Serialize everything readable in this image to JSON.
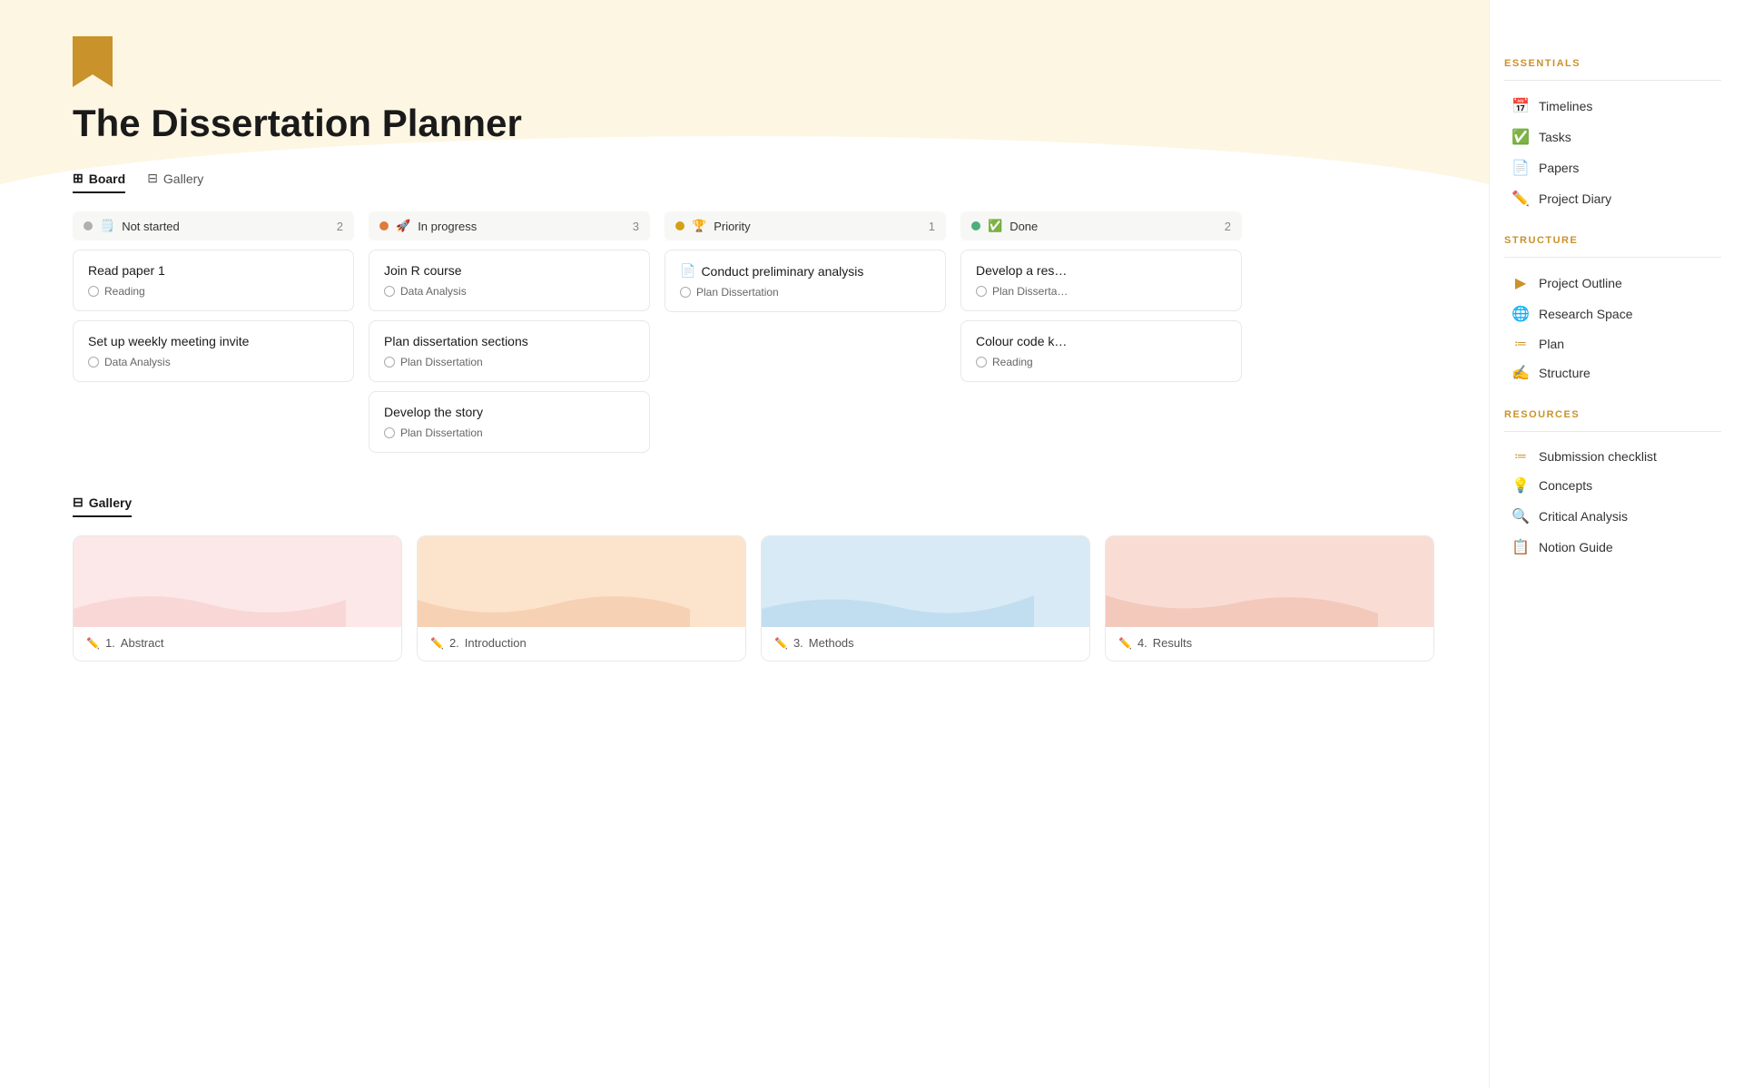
{
  "page": {
    "title": "The Dissertation Planner",
    "icon": "bookmark"
  },
  "tabs": [
    {
      "id": "board",
      "label": "Board",
      "icon": "⊞",
      "active": true
    },
    {
      "id": "gallery",
      "label": "Gallery",
      "icon": "⊟",
      "active": false
    }
  ],
  "board": {
    "columns": [
      {
        "id": "not-started",
        "status_dot": "gray",
        "emoji": "🗒️",
        "label": "Not started",
        "count": 2,
        "cards": [
          {
            "title": "Read paper 1",
            "doc_icon": null,
            "tag": "Reading"
          },
          {
            "title": "Set up weekly meeting invite",
            "doc_icon": null,
            "tag": "Data Analysis"
          }
        ]
      },
      {
        "id": "in-progress",
        "status_dot": "orange",
        "emoji": "🚀",
        "label": "In progress",
        "count": 3,
        "cards": [
          {
            "title": "Join R course",
            "doc_icon": null,
            "tag": "Data Analysis"
          },
          {
            "title": "Plan dissertation sections",
            "doc_icon": null,
            "tag": "Plan Dissertation"
          },
          {
            "title": "Develop the story",
            "doc_icon": null,
            "tag": "Plan Dissertation"
          }
        ]
      },
      {
        "id": "priority",
        "status_dot": "yellow",
        "emoji": "🏆",
        "label": "Priority",
        "count": 1,
        "cards": [
          {
            "title": "Conduct preliminary analysis",
            "doc_icon": "📄",
            "tag": "Plan Dissertation"
          }
        ]
      },
      {
        "id": "done",
        "status_dot": "green",
        "emoji": "✅",
        "label": "Done",
        "count": 2,
        "cards": [
          {
            "title": "Develop a res…",
            "doc_icon": null,
            "tag": "Plan Disserta…"
          },
          {
            "title": "Colour code k…",
            "doc_icon": null,
            "tag": "Reading"
          }
        ]
      }
    ]
  },
  "gallery": {
    "cards": [
      {
        "number": "1",
        "label": "Abstract",
        "color_class": "gc-pink",
        "wave_color": "#f8d0d0"
      },
      {
        "number": "2",
        "label": "Introduction",
        "color_class": "gc-peach",
        "wave_color": "#f5c9a8"
      },
      {
        "number": "3",
        "label": "Methods",
        "color_class": "gc-blue",
        "wave_color": "#b8d8ee"
      },
      {
        "number": "4",
        "label": "Results",
        "color_class": "gc-salmon",
        "wave_color": "#f0c0b0"
      }
    ]
  },
  "sidebar": {
    "essentials_title": "ESSENTIALS",
    "structure_title": "STRUCTURE",
    "resources_title": "RESOURCES",
    "essentials": [
      {
        "icon": "📅",
        "label": "Timelines"
      },
      {
        "icon": "✅",
        "label": "Tasks"
      },
      {
        "icon": "📄",
        "label": "Papers"
      },
      {
        "icon": "✏️",
        "label": "Project Diary"
      }
    ],
    "structure": [
      {
        "icon": "▶️",
        "label": "Project Outline"
      },
      {
        "icon": "🌐",
        "label": "Research Space"
      },
      {
        "icon": "≔",
        "label": "Plan"
      },
      {
        "icon": "✍️",
        "label": "Structure"
      }
    ],
    "resources": [
      {
        "icon": "≔",
        "label": "Submission checklist"
      },
      {
        "icon": "💡",
        "label": "Concepts"
      },
      {
        "icon": "🔍",
        "label": "Critical Analysis"
      },
      {
        "icon": "📋",
        "label": "Notion Guide"
      }
    ]
  }
}
